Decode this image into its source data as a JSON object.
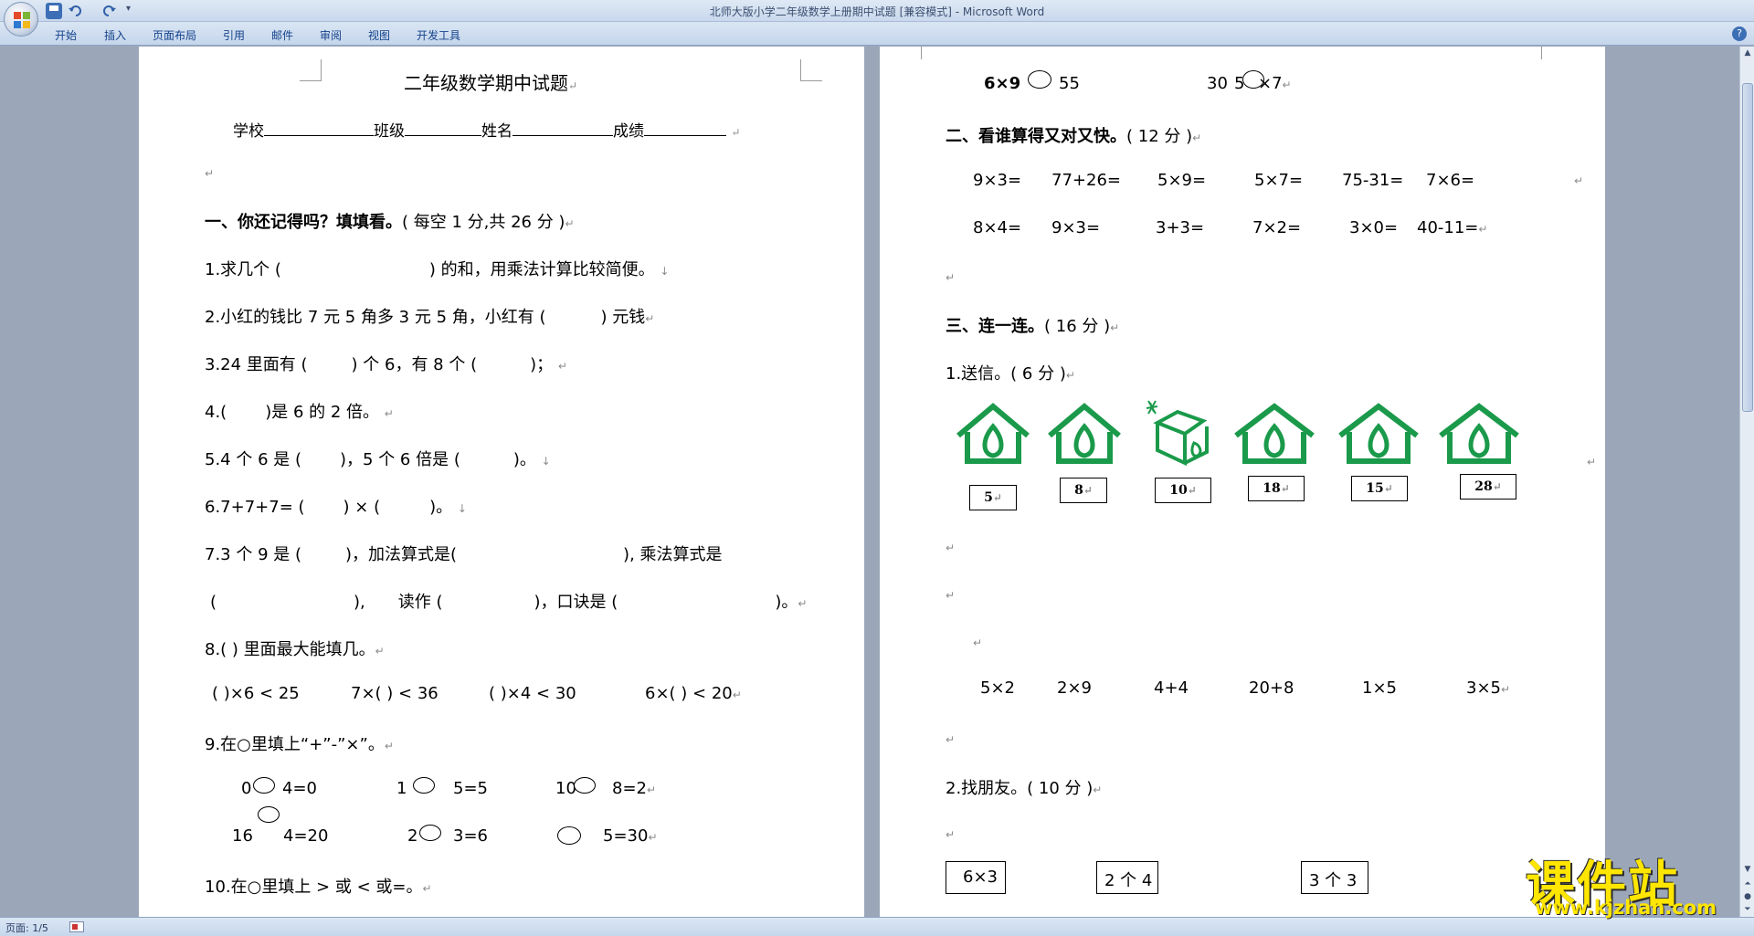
{
  "window": {
    "title": "北师大版小学二年级数学上册期中试题 [兼容模式] - Microsoft Word",
    "ribbon_tabs": [
      "开始",
      "插入",
      "页面布局",
      "引用",
      "邮件",
      "审阅",
      "视图",
      "开发工具"
    ]
  },
  "status": {
    "page": "页面: 1/5"
  },
  "paragraph_mark": "↵",
  "line_mark": "↓",
  "colors": {
    "house_green": "#1a9a4a",
    "watermark_yellow": "#ffe600"
  },
  "left_page": {
    "title": "二年级数学期中试题",
    "info": {
      "school": "学校",
      "class": "班级",
      "name": "姓名",
      "score": "成绩"
    },
    "section1": {
      "heading": "一、你还记得吗？填填看。",
      "points": "( 每空 1 分,共 26 分 )"
    },
    "q1": {
      "a": "1.求几个 (",
      "b": ") 的和，用乘法计算比较简便。"
    },
    "q2": {
      "a": "2.小红的钱比 7 元 5 角多 3 元 5 角，小红有 (",
      "b": ") 元钱"
    },
    "q3": {
      "a": "3.24 里面有 (",
      "b": ") 个 6，有 8 个 (",
      "c": ")；"
    },
    "q4": {
      "a": "4.(",
      "b": ")是 6 的 2 倍。"
    },
    "q5": {
      "a": "5.4 个 6 是 (",
      "b": ")，5 个 6 倍是 (",
      "c": ")。"
    },
    "q6": {
      "a": "6.7+7+7= (",
      "b": ") × (",
      "c": ")。"
    },
    "q7": {
      "a": "7.3  个  9  是 (",
      "b": ")，加法算式是(",
      "c": "), 乘法算式是",
      "d": "(",
      "e": "),",
      "f": "读作 (",
      "g": ")，口诀是 (",
      "h": ")。"
    },
    "q8": {
      "text": "8.(    ) 里面最大能填几。",
      "items": [
        "(    )×6 < 25",
        "7×(    ) < 36",
        "(    )×4 < 30",
        "6×(    ) < 20"
      ]
    },
    "q9": {
      "text": "9.在○里填上“+”-”×”。",
      "r1": [
        "0",
        "4=0",
        "1",
        "5=5",
        "10",
        "8=2"
      ],
      "r2": [
        "16",
        "4=20",
        "2",
        "3=6",
        "5=30"
      ]
    },
    "q10": {
      "text": "10.在○里填上 > 或 < 或=。"
    }
  },
  "right_page": {
    "top": [
      "6×9",
      "55",
      "30",
      "5",
      "×7"
    ],
    "section2": {
      "heading": "二、看谁算得又对又快。",
      "points": "( 12 分 )"
    },
    "calc_r1": [
      "9×3=",
      "77+26=",
      "5×9=",
      "5×7=",
      "75-31=",
      "7×6="
    ],
    "calc_r2": [
      "8×4=",
      "9×3=",
      "3+3=",
      "7×2=",
      "3×0=",
      "40-11="
    ],
    "section3": {
      "heading": "三、连一连。",
      "points": "( 16 分 )"
    },
    "sub1": "1.送信。( 6 分 )",
    "house_numbers": [
      "5",
      "8",
      "10",
      "18",
      "15",
      "28"
    ],
    "letters": [
      "5×2",
      "2×9",
      "4+4",
      "20+8",
      "1×5",
      "3×5"
    ],
    "sub2": "2.找朋友。( 10 分 )",
    "friends": [
      "6×3",
      "2 个 4",
      "3 个 3"
    ]
  },
  "watermark": {
    "cn": "课件站",
    "url": "www.kjzhan.com"
  }
}
